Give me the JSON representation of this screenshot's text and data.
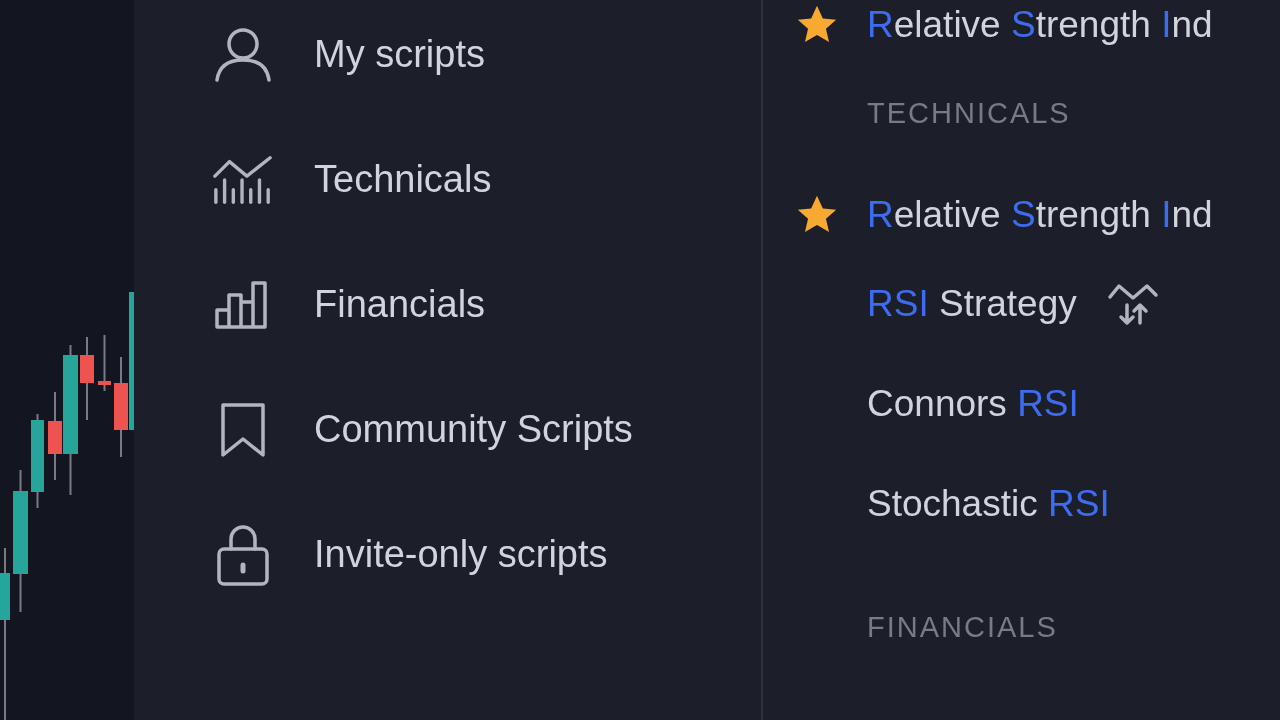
{
  "sidebar": {
    "items": [
      {
        "label": "My scripts"
      },
      {
        "label": "Technicals"
      },
      {
        "label": "Financials"
      },
      {
        "label": "Community Scripts"
      },
      {
        "label": "Invite-only scripts"
      }
    ]
  },
  "results": [
    {
      "kind": "script",
      "favorite": true,
      "strategy": false,
      "segments": [
        {
          "text": "R",
          "match": true
        },
        {
          "text": "elative ",
          "match": false
        },
        {
          "text": "S",
          "match": true
        },
        {
          "text": "trength ",
          "match": false
        },
        {
          "text": "I",
          "match": true
        },
        {
          "text": "nd",
          "match": false
        }
      ]
    },
    {
      "kind": "section",
      "label": "TECHNICALS"
    },
    {
      "kind": "script",
      "favorite": true,
      "strategy": false,
      "segments": [
        {
          "text": "R",
          "match": true
        },
        {
          "text": "elative ",
          "match": false
        },
        {
          "text": "S",
          "match": true
        },
        {
          "text": "trength ",
          "match": false
        },
        {
          "text": "I",
          "match": true
        },
        {
          "text": "nd",
          "match": false
        }
      ]
    },
    {
      "kind": "script",
      "favorite": false,
      "strategy": true,
      "segments": [
        {
          "text": "RSI",
          "match": true
        },
        {
          "text": " Strategy",
          "match": false
        }
      ]
    },
    {
      "kind": "script",
      "favorite": false,
      "strategy": false,
      "segments": [
        {
          "text": "Connors ",
          "match": false
        },
        {
          "text": "RSI",
          "match": true
        }
      ]
    },
    {
      "kind": "script",
      "favorite": false,
      "strategy": false,
      "segments": [
        {
          "text": "Stochastic ",
          "match": false
        },
        {
          "text": "RSI",
          "match": true
        }
      ]
    },
    {
      "kind": "section",
      "label": "FINANCIALS"
    }
  ]
}
